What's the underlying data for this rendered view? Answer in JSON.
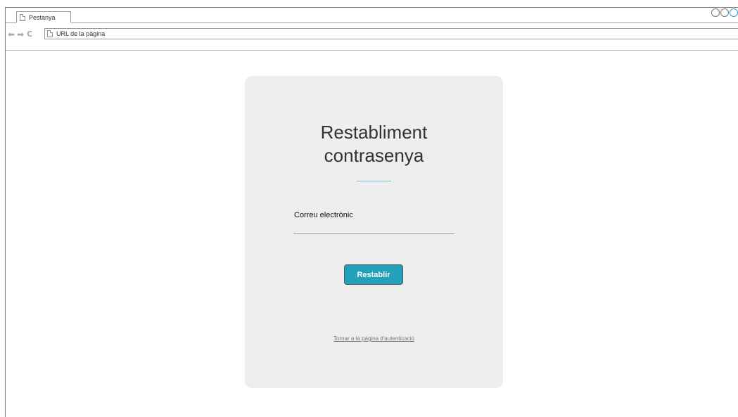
{
  "browser": {
    "tab_label": "Pestanya",
    "url_placeholder": "URL de la pàgina"
  },
  "form": {
    "title_line1": "Restabliment",
    "title_line2": "contrasenya",
    "email_label": "Correu electrònic",
    "email_value": "",
    "submit_label": "Restablir",
    "back_link": "Tornar a la pàgina d'autenticació"
  },
  "colors": {
    "accent": "#22a1b8",
    "card_background": "#eeeeee",
    "divider": "#7bbfd3"
  },
  "icons": {
    "nav_back": "back-arrow-icon",
    "nav_forward": "forward-arrow-icon",
    "nav_reload": "reload-icon",
    "page": "page-icon"
  }
}
